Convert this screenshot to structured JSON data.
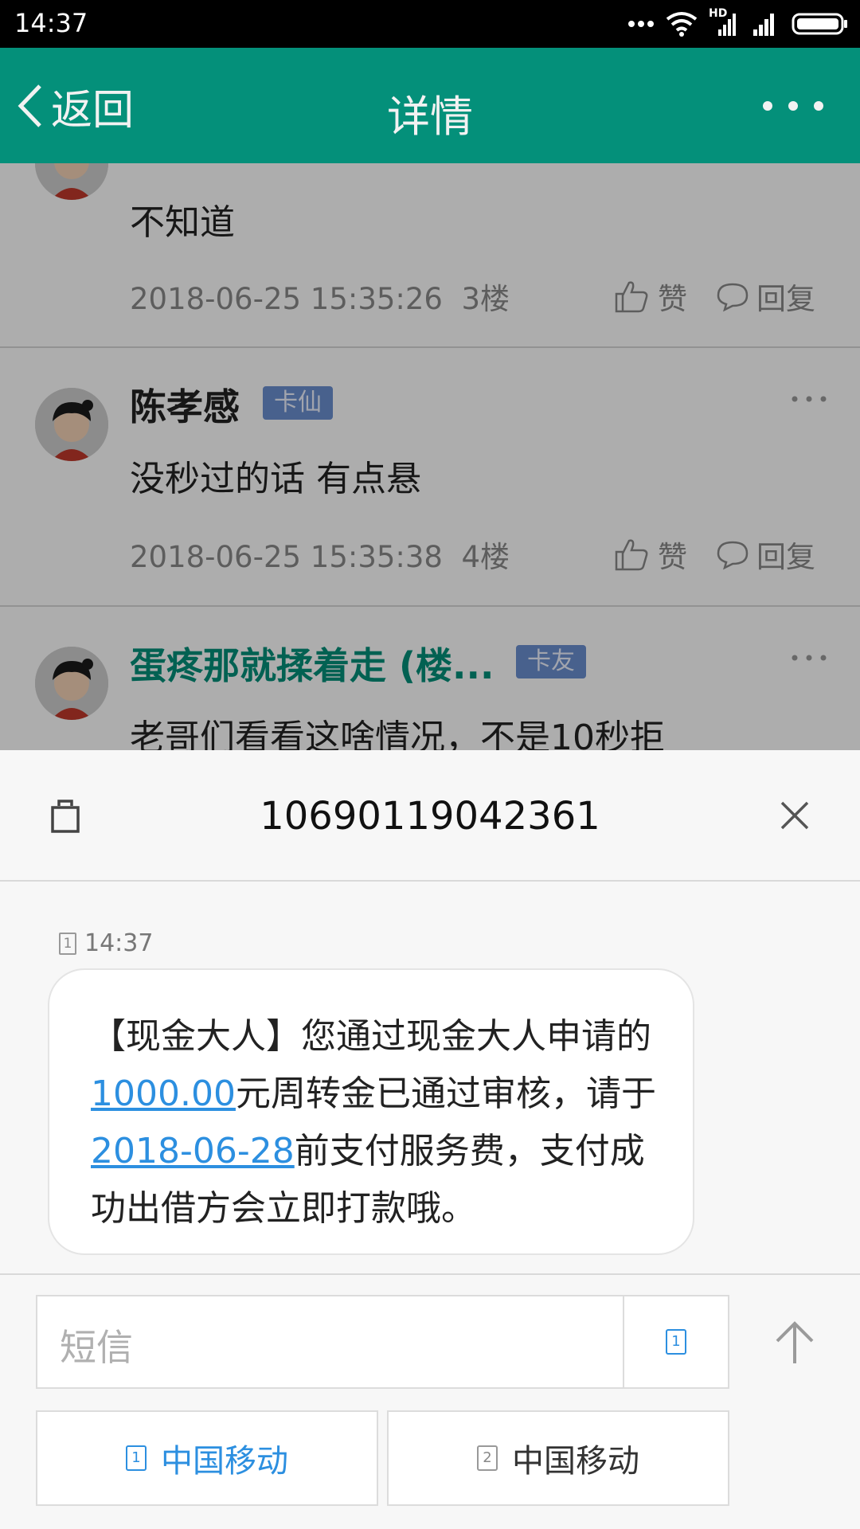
{
  "status_bar": {
    "time": "14:37",
    "icons": [
      "more-dots-icon",
      "wifi-icon",
      "hd-signal-icon",
      "signal-icon",
      "battery-icon"
    ],
    "hd_label": "HD"
  },
  "app_bar": {
    "back_label": "返回",
    "title": "详情",
    "background": "#04907a"
  },
  "comments": [
    {
      "text": "不知道",
      "timestamp": "2018-06-25 15:35:26",
      "floor": "3楼",
      "like_label": "赞",
      "reply_label": "回复"
    },
    {
      "name": "陈孝感",
      "badge": "卡仙",
      "text": "没秒过的话 有点悬",
      "timestamp": "2018-06-25 15:35:38",
      "floor": "4楼",
      "like_label": "赞",
      "reply_label": "回复"
    },
    {
      "name": "蛋疼那就揉着走 (楼...",
      "badge": "卡友",
      "text": "老哥们看看这啥情况，不是10秒拒"
    }
  ],
  "sms": {
    "sender": "10690119042361",
    "received_time": "14:37",
    "sim_slot": "1",
    "message": {
      "prefix": "【现金大人】您通过现金大人申请的",
      "amount": "1000.00",
      "middle": "元周转金已通过审核，请于",
      "date": "2018-06-28",
      "suffix": "前支付服务费，支付成功出借方会立即打款哦。"
    },
    "compose_placeholder": "短信",
    "compose_sim": "1",
    "sim_options": [
      {
        "slot": "1",
        "label": "中国移动"
      },
      {
        "slot": "2",
        "label": "中国移动"
      }
    ],
    "link_color": "#2c8fe0"
  }
}
